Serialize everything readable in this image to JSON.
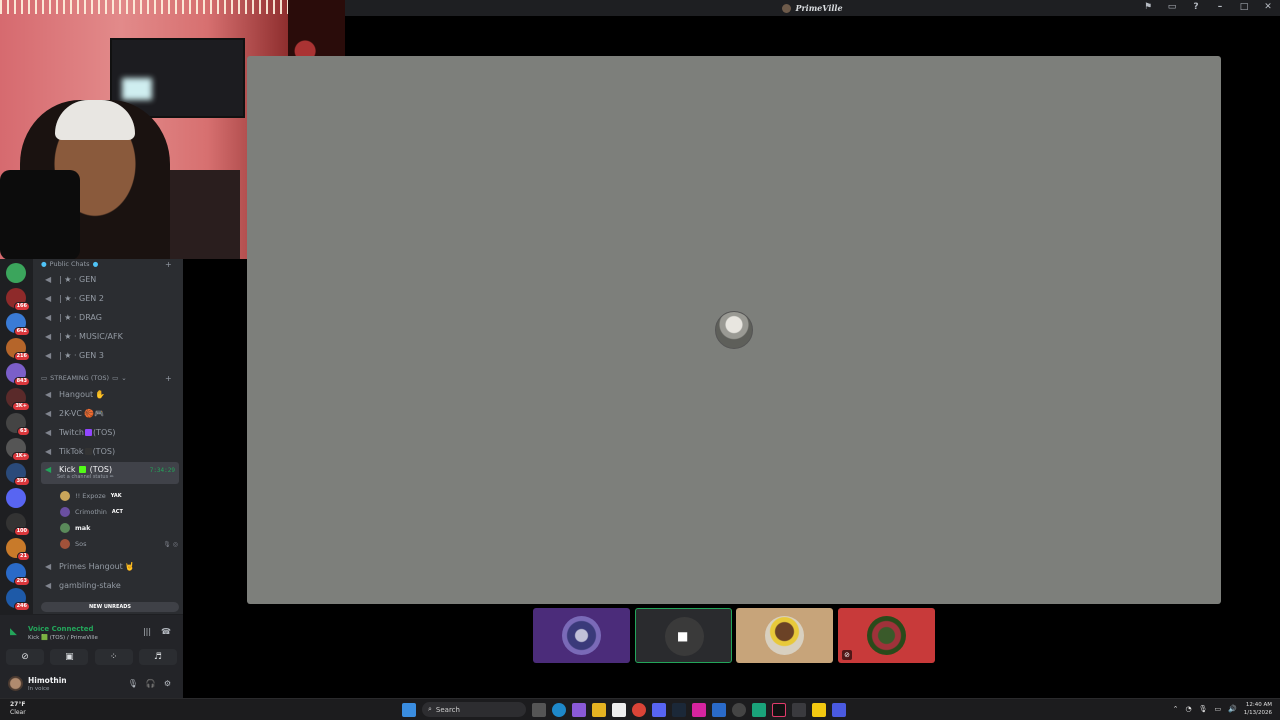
{
  "window": {
    "title": "PrimeVille"
  },
  "titlebar_icons": [
    "flag-icon",
    "inbox-icon",
    "help-icon",
    "minimize-icon",
    "maximize-icon",
    "close-icon"
  ],
  "servers": [
    {
      "badge": "",
      "color": "#3ba55c"
    },
    {
      "badge": "166",
      "color": "#8e2a2a"
    },
    {
      "badge": "642",
      "color": "#3a7bd5"
    },
    {
      "badge": "216",
      "color": "#b5652a"
    },
    {
      "badge": "843",
      "color": "#7b5fc9"
    },
    {
      "badge": "3K+",
      "color": "#5a2a2a"
    },
    {
      "badge": "63",
      "color": "#444"
    },
    {
      "badge": "1K+",
      "color": "#555"
    },
    {
      "badge": "397",
      "color": "#2a4a7a"
    },
    {
      "badge": "",
      "color": "#5865f2"
    },
    {
      "badge": "100",
      "color": "#333"
    },
    {
      "badge": "21",
      "color": "#c87a2a"
    },
    {
      "badge": "263",
      "color": "#2a6ac8"
    },
    {
      "badge": "246",
      "color": "#1e5aa8"
    }
  ],
  "categories": {
    "public": "Public Chats",
    "streaming": "STREAMING (TOS)"
  },
  "public_channels": [
    {
      "label": "| ★ · GEN"
    },
    {
      "label": "| ★ · GEN 2"
    },
    {
      "label": "| ★ · DRAG"
    },
    {
      "label": "| ★ · MUSIC/AFK"
    },
    {
      "label": "| ★ · GEN 3"
    }
  ],
  "streaming_channels": [
    {
      "label": "Hangout",
      "emoji": "✋"
    },
    {
      "label": "2K-VC",
      "emoji": "🏀🎮"
    },
    {
      "label": "Twitch",
      "suffix": "(TOS)"
    },
    {
      "label": "TikTok",
      "suffix": "(TOS)"
    }
  ],
  "active_channel": {
    "label": "Kick",
    "suffix": "(TOS)",
    "timer": "7:34:29",
    "status": "Set a channel status ✏"
  },
  "voice_users": [
    {
      "name": "!! Expoze",
      "tag": "YAK",
      "color": "#c9a55a"
    },
    {
      "name": "Crimothin",
      "tag": "ACT",
      "color": "#6a4fa0"
    },
    {
      "name": "mak",
      "tag": "",
      "color": "#5a8a5a"
    },
    {
      "name": "Sos",
      "tag": "",
      "color": "#a0523a"
    }
  ],
  "after_channels": [
    {
      "label": "Primes Hangout",
      "emoji": "🤘"
    },
    {
      "label": "gambling-stake"
    }
  ],
  "new_unreads": "NEW UNREADS",
  "voice_panel": {
    "title": "Voice Connected",
    "subtitle": "Kick 🟩 (TOS) / PrimeVille"
  },
  "user_panel": {
    "name": "Himothin",
    "status": "In voice"
  },
  "taskbar": {
    "weather_temp": "27°F",
    "weather_desc": "Clear",
    "search_label": "Search",
    "time": "12:40 AM",
    "date": "1/13/2026"
  },
  "colors": {
    "voice_green": "#23a55a",
    "stage_bg": "#7d7f7b",
    "badge_red": "#da373c"
  }
}
